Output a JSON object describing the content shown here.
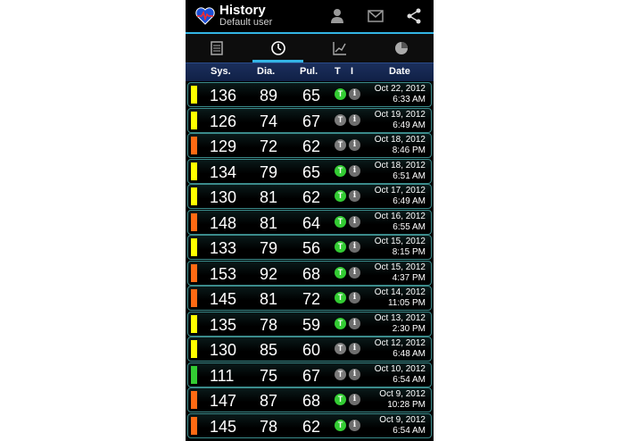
{
  "app": {
    "title": "History",
    "subtitle": "Default user"
  },
  "actions": [
    "user-icon",
    "mail-icon",
    "share-icon"
  ],
  "tabs": [
    {
      "name": "list-icon",
      "active": false
    },
    {
      "name": "gauge-icon",
      "active": true
    },
    {
      "name": "line-chart-icon",
      "active": false
    },
    {
      "name": "pie-chart-icon",
      "active": false
    }
  ],
  "columns": {
    "sys": "Sys.",
    "dia": "Dia.",
    "pul": "Pul.",
    "t": "T",
    "i": "I",
    "date": "Date"
  },
  "colors": {
    "accent": "#33b5e5",
    "yellow": "#ffff00",
    "orange": "#ff6a13",
    "green": "#33cc33"
  },
  "rows": [
    {
      "sys": "136",
      "dia": "89",
      "pul": "65",
      "t_active": true,
      "date": "Oct 22, 2012",
      "time": "6:33 AM",
      "level": "yellow"
    },
    {
      "sys": "126",
      "dia": "74",
      "pul": "67",
      "t_active": false,
      "date": "Oct 19, 2012",
      "time": "6:49 AM",
      "level": "yellow"
    },
    {
      "sys": "129",
      "dia": "72",
      "pul": "62",
      "t_active": false,
      "date": "Oct 18, 2012",
      "time": "8:46 PM",
      "level": "orange"
    },
    {
      "sys": "134",
      "dia": "79",
      "pul": "65",
      "t_active": true,
      "date": "Oct 18, 2012",
      "time": "6:51 AM",
      "level": "yellow"
    },
    {
      "sys": "130",
      "dia": "81",
      "pul": "62",
      "t_active": true,
      "date": "Oct 17, 2012",
      "time": "6:49 AM",
      "level": "yellow"
    },
    {
      "sys": "148",
      "dia": "81",
      "pul": "64",
      "t_active": true,
      "date": "Oct 16, 2012",
      "time": "6:55 AM",
      "level": "orange"
    },
    {
      "sys": "133",
      "dia": "79",
      "pul": "56",
      "t_active": true,
      "date": "Oct 15, 2012",
      "time": "8:15 PM",
      "level": "yellow"
    },
    {
      "sys": "153",
      "dia": "92",
      "pul": "68",
      "t_active": true,
      "date": "Oct 15, 2012",
      "time": "4:37 PM",
      "level": "orange"
    },
    {
      "sys": "145",
      "dia": "81",
      "pul": "72",
      "t_active": true,
      "date": "Oct 14, 2012",
      "time": "11:05 PM",
      "level": "orange"
    },
    {
      "sys": "135",
      "dia": "78",
      "pul": "59",
      "t_active": true,
      "date": "Oct 13, 2012",
      "time": "2:30 PM",
      "level": "yellow"
    },
    {
      "sys": "130",
      "dia": "85",
      "pul": "60",
      "t_active": false,
      "date": "Oct 12, 2012",
      "time": "6:48 AM",
      "level": "yellow"
    },
    {
      "sys": "111",
      "dia": "75",
      "pul": "67",
      "t_active": false,
      "date": "Oct 10, 2012",
      "time": "6:54 AM",
      "level": "green"
    },
    {
      "sys": "147",
      "dia": "87",
      "pul": "68",
      "t_active": true,
      "date": "Oct 9, 2012",
      "time": "10:28 PM",
      "level": "orange"
    },
    {
      "sys": "145",
      "dia": "78",
      "pul": "62",
      "t_active": true,
      "date": "Oct 9, 2012",
      "time": "6:54 AM",
      "level": "orange"
    }
  ]
}
